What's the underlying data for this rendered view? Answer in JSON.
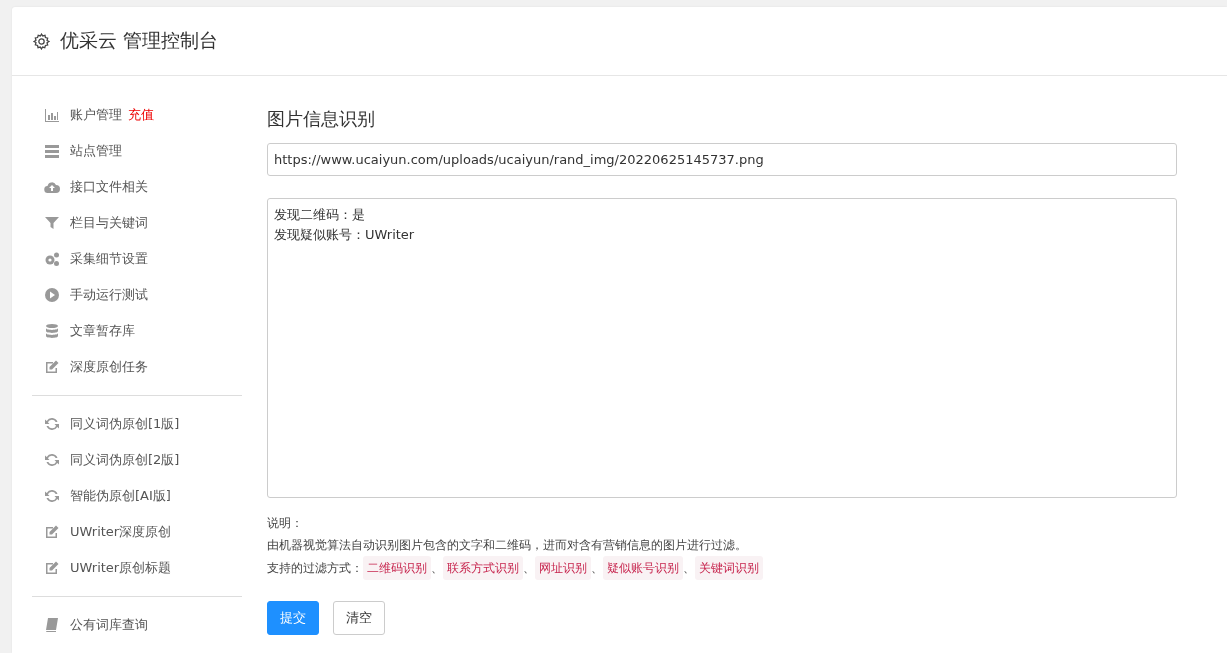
{
  "header": {
    "title": "优采云 管理控制台"
  },
  "sidebar": {
    "groups": [
      {
        "items": [
          {
            "label": "账户管理",
            "badge": "充值",
            "kind": "chart"
          },
          {
            "label": "站点管理",
            "kind": "server"
          },
          {
            "label": "接口文件相关",
            "kind": "cloud"
          },
          {
            "label": "栏目与关键词",
            "kind": "filter"
          },
          {
            "label": "采集细节设置",
            "kind": "gears"
          },
          {
            "label": "手动运行测试",
            "kind": "play"
          },
          {
            "label": "文章暂存库",
            "kind": "database"
          },
          {
            "label": "深度原创任务",
            "kind": "edit"
          }
        ]
      },
      {
        "items": [
          {
            "label": "同义词伪原创[1版]",
            "kind": "refresh"
          },
          {
            "label": "同义词伪原创[2版]",
            "kind": "refresh"
          },
          {
            "label": "智能伪原创[AI版]",
            "kind": "refresh"
          },
          {
            "label": "UWriter深度原创",
            "kind": "edit"
          },
          {
            "label": "UWriter原创标题",
            "kind": "edit"
          }
        ]
      },
      {
        "items": [
          {
            "label": "公有词库查询",
            "kind": "book"
          }
        ]
      }
    ]
  },
  "main": {
    "title": "图片信息识别",
    "url_field": {
      "value": "https://www.ucaiyun.com/uploads/ucaiyun/rand_img/20220625145737.png"
    },
    "result_box": {
      "lines": [
        "发现二维码：是",
        "发现疑似账号：UWriter"
      ]
    },
    "notes": {
      "heading": "说明：",
      "description": "由机器视觉算法自动识别图片包含的文字和二维码，进而对含有营销信息的图片进行过滤。",
      "methods_label": "支持的过滤方式：",
      "separator": "、",
      "methods": [
        "二维码识别",
        "联系方式识别",
        "网址识别",
        "疑似账号识别",
        "关键词识别"
      ]
    },
    "buttons": [
      {
        "label": "提交",
        "kind": "primary"
      },
      {
        "label": "清空",
        "kind": "default"
      }
    ]
  }
}
